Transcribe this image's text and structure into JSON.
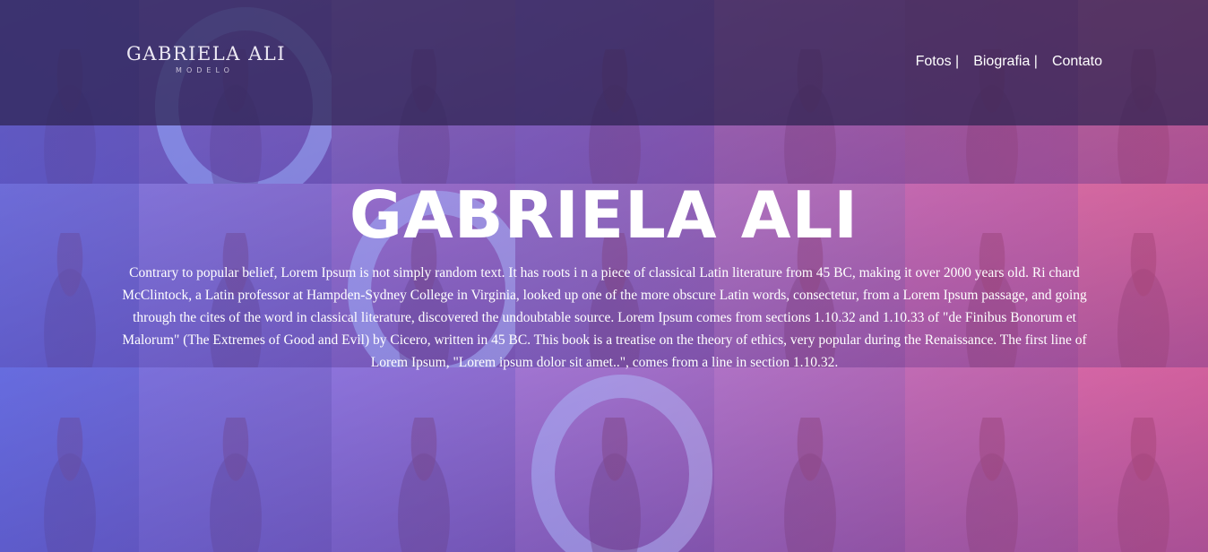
{
  "brand": {
    "name": "GABRIELA ALI",
    "tagline": "MODELO"
  },
  "nav": {
    "items": [
      {
        "label": "Fotos |"
      },
      {
        "label": "Biografia |"
      },
      {
        "label": "Contato"
      }
    ]
  },
  "hero": {
    "title": "GABRIELA ALI",
    "text": "Contrary to popular belief, Lorem Ipsum is not simply random text. It has roots i n a piece of classical Latin literature from 45 BC, making it over 2000 years old. Ri chard McClintock, a Latin professor at Hampden-Sydney College in Virginia, looked up one of the more obscure Latin words, consectetur, from a Lorem Ipsum passage, and going through the cites of the word in classical literature, discovered the undoubtable source. Lorem Ipsum comes from sections 1.10.32 and 1.10.33 of \"de Finibus Bonorum et Malorum\" (The Extremes of Good and Evil) by Cicero, written in 45 BC. This book is a treatise on the theory of ethics, very popular during the Renaissance. The first line of Lorem Ipsum, \"Lorem ipsum dolor sit amet..\", comes from a line in section 1.10.32."
  },
  "colors": {
    "header_bg": "#2d2350",
    "gradient_left": "#6e6eff",
    "gradient_right": "#f05faa",
    "text": "#ffffff"
  }
}
